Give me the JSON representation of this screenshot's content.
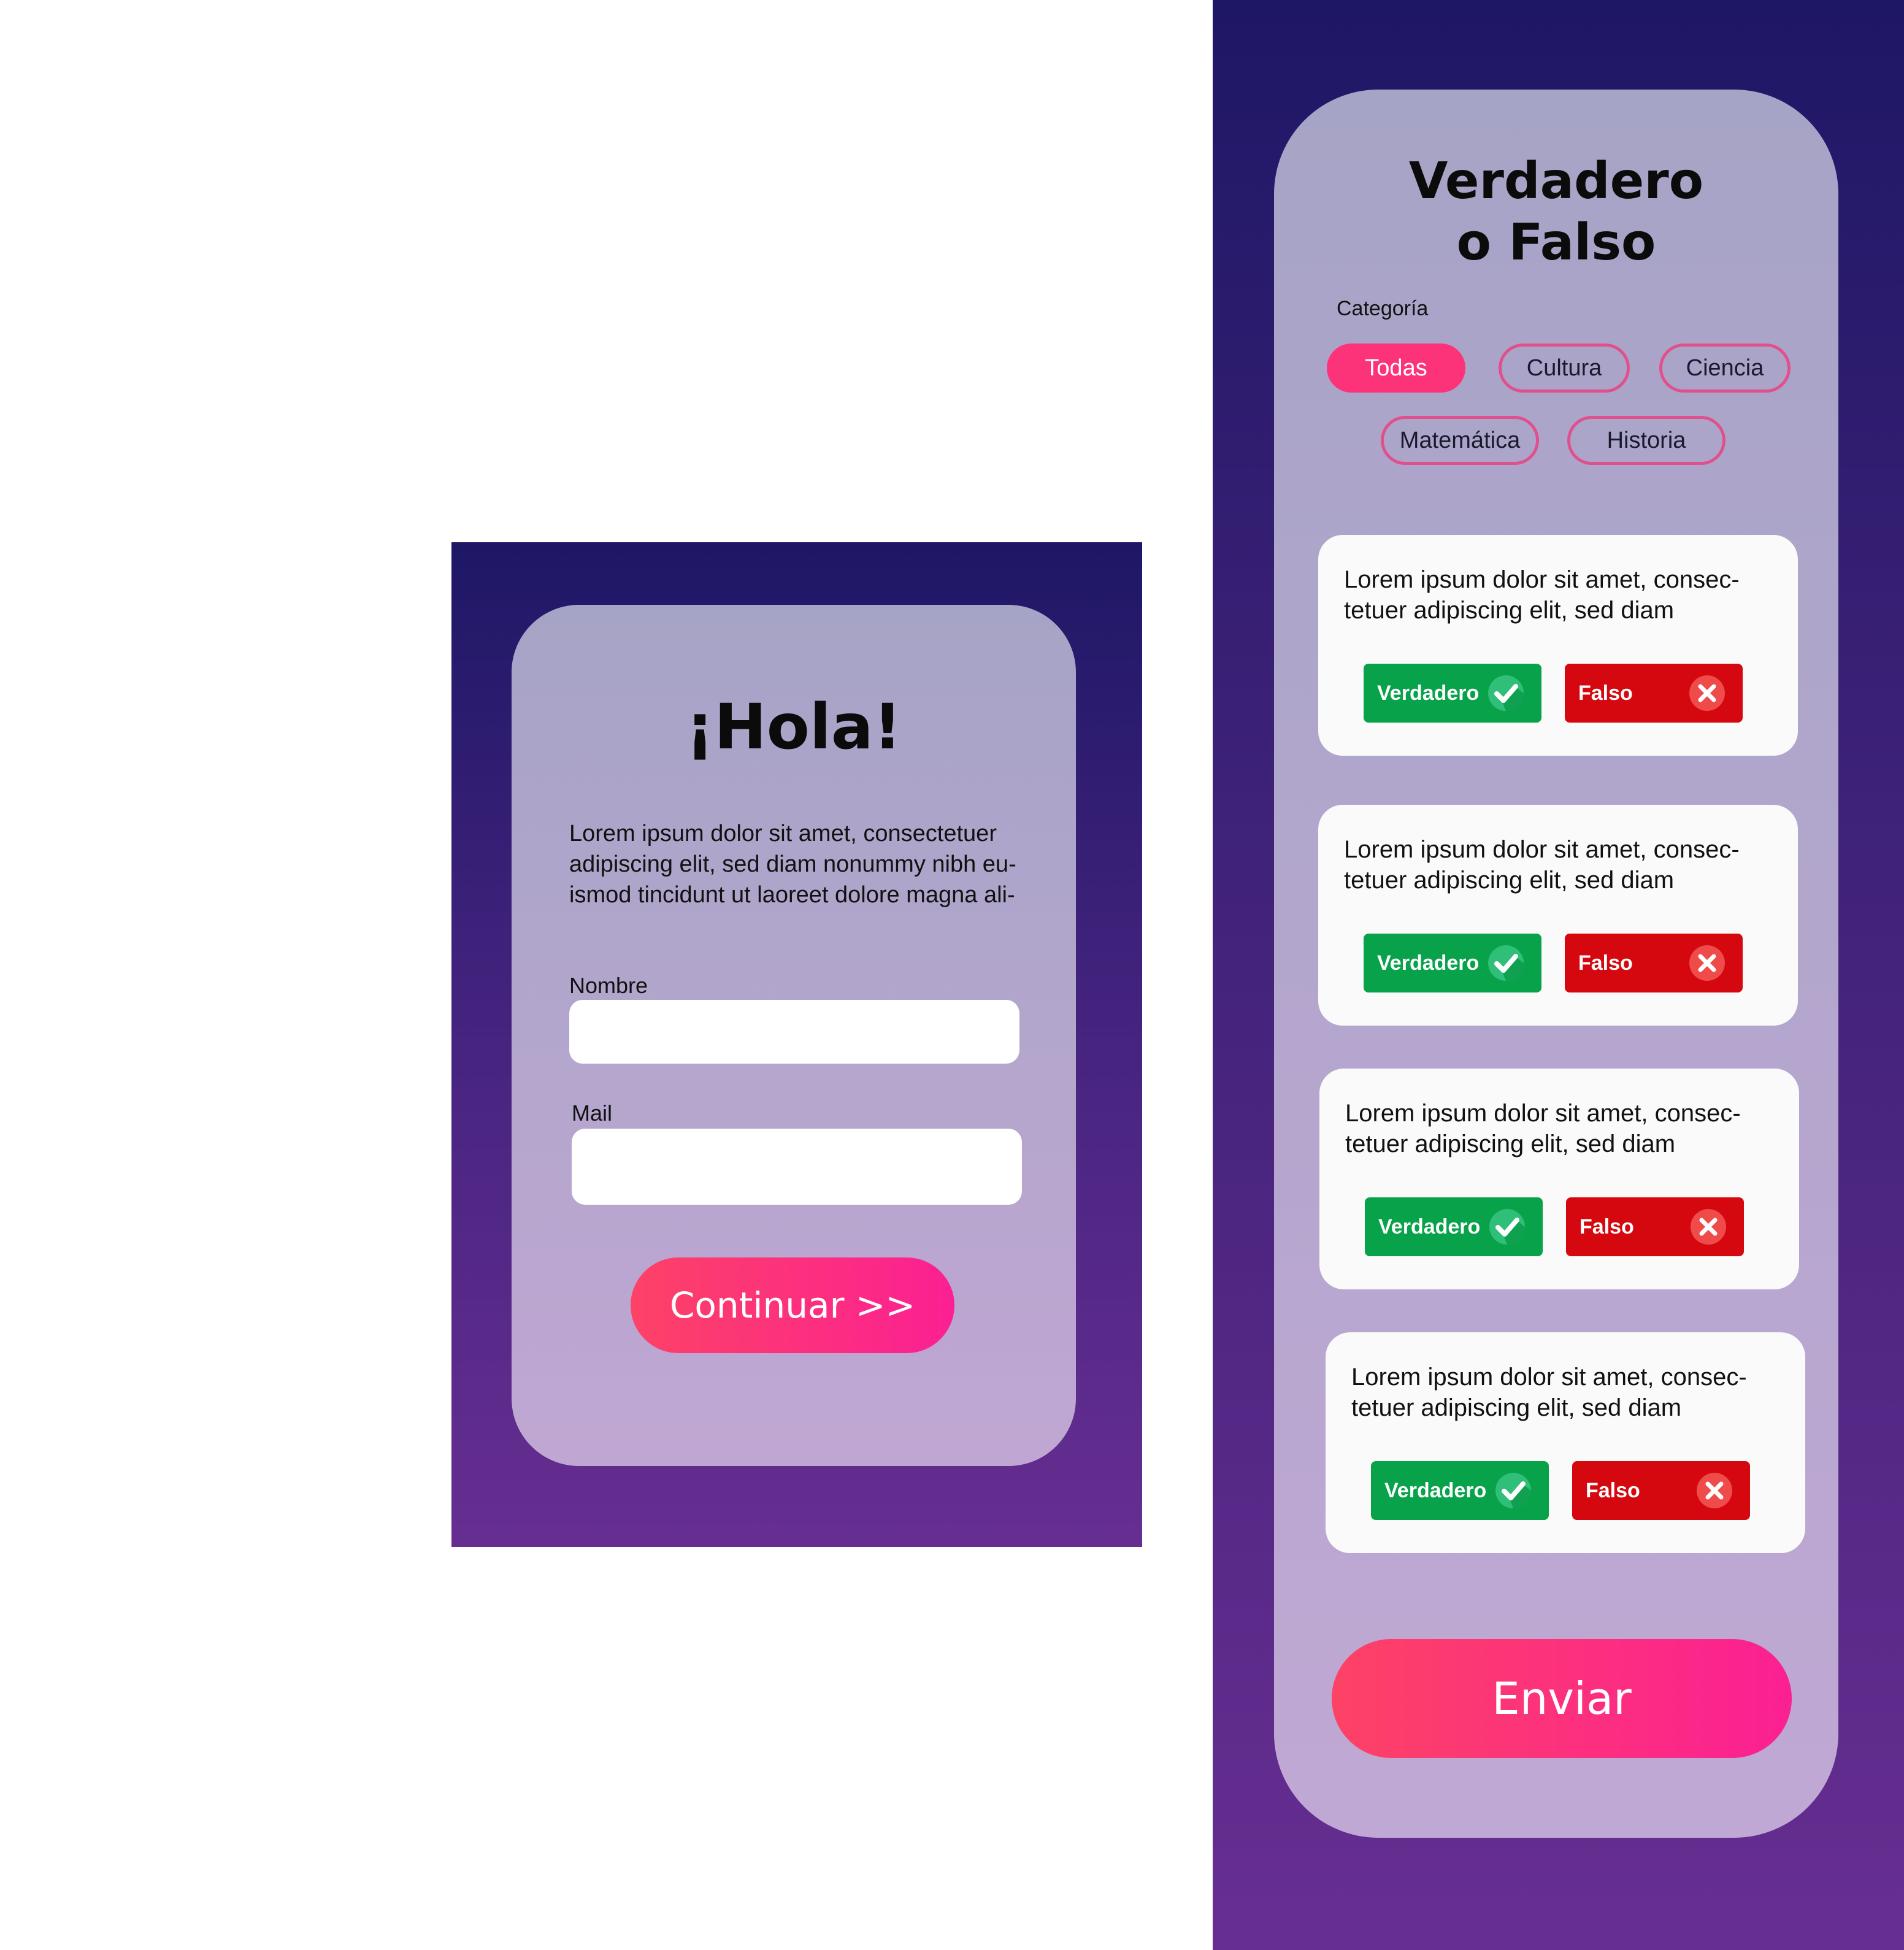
{
  "welcome": {
    "title": "¡Hola!",
    "intro": "Lorem ipsum dolor sit amet, consectetuer adipiscing elit, sed diam nonummy nibh eu- ismod tincidunt ut laoreet dolore magna ali-",
    "name_label": "Nombre",
    "name_value": "",
    "mail_label": "Mail",
    "mail_value": "",
    "continue_label": "Continuar >>"
  },
  "quiz": {
    "title": "Verdadero o Falso",
    "category_label": "Categoría",
    "categories": [
      {
        "label": "Todas",
        "selected": true
      },
      {
        "label": "Cultura",
        "selected": false
      },
      {
        "label": "Ciencia",
        "selected": false
      },
      {
        "label": "Matemática",
        "selected": false
      },
      {
        "label": "Historia",
        "selected": false
      }
    ],
    "questions": [
      {
        "text": "Lorem ipsum dolor sit amet, consec- tetuer adipiscing elit, sed diam",
        "true_label": "Verdadero",
        "false_label": "Falso"
      },
      {
        "text": "Lorem ipsum dolor sit amet, consec- tetuer adipiscing elit, sed diam",
        "true_label": "Verdadero",
        "false_label": "Falso"
      },
      {
        "text": "Lorem ipsum dolor sit amet, consec- tetuer adipiscing elit, sed diam",
        "true_label": "Verdadero",
        "false_label": "Falso"
      },
      {
        "text": "Lorem ipsum dolor sit amet, consec- tetuer adipiscing elit, sed diam",
        "true_label": "Verdadero",
        "false_label": "Falso"
      }
    ],
    "submit_label": "Enviar"
  },
  "colors": {
    "background_top": "#1e1766",
    "background_bottom": "#662e91",
    "accent_pink": "#fd3379",
    "true_green": "#07a24a",
    "false_red": "#d6080f"
  },
  "icons": {
    "true": "check-circle-icon",
    "false": "x-circle-icon"
  }
}
